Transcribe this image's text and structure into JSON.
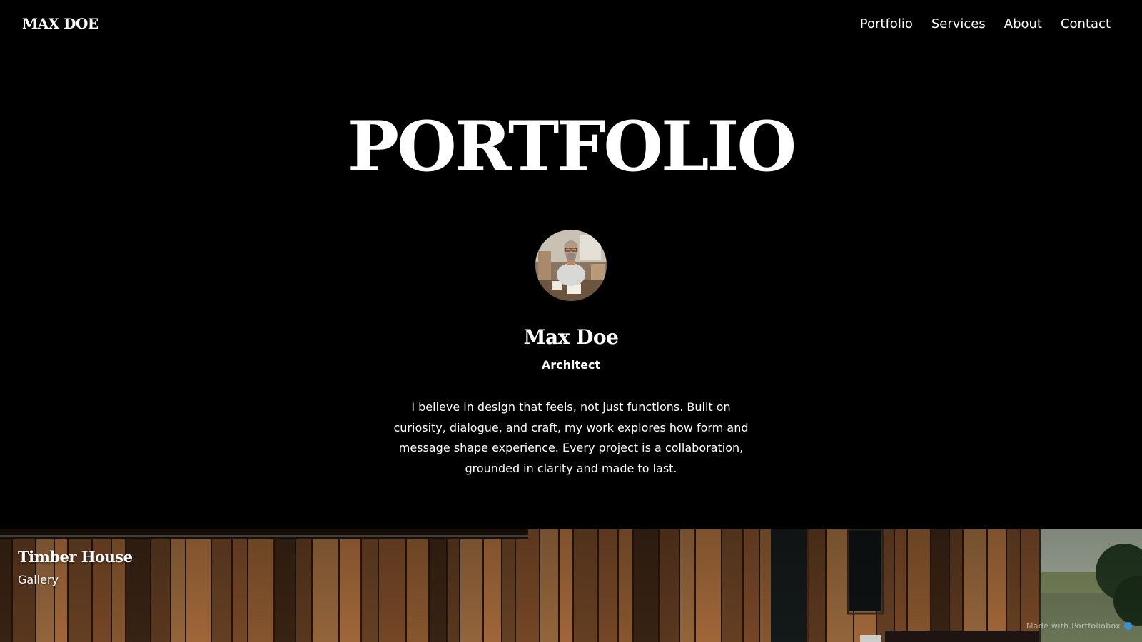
{
  "brand": {
    "logo": "MAX DOE"
  },
  "nav": {
    "items": [
      {
        "label": "Portfolio"
      },
      {
        "label": "Services"
      },
      {
        "label": "About"
      },
      {
        "label": "Contact"
      }
    ]
  },
  "hero": {
    "title": "PORTFOLIO"
  },
  "profile": {
    "avatar_icon": "person-photo-avatar",
    "name": "Max Doe",
    "role": "Architect",
    "bio": "I believe in design that feels, not just functions. Built on curiosity, dialogue, and craft, my work explores how form and message shape experience. Every project is a collaboration, grounded in clarity and made to last."
  },
  "projects": [
    {
      "title": "Timber House",
      "category": "Gallery"
    }
  ],
  "footer": {
    "made_with": "Made with Portfoliobox"
  },
  "colors": {
    "background": "#000000",
    "text": "#ffffff",
    "timber_dark": "#3a2414",
    "timber_mid": "#7a4a28",
    "timber_light": "#a86c3c",
    "badge_accent": "#3b8fd6"
  }
}
